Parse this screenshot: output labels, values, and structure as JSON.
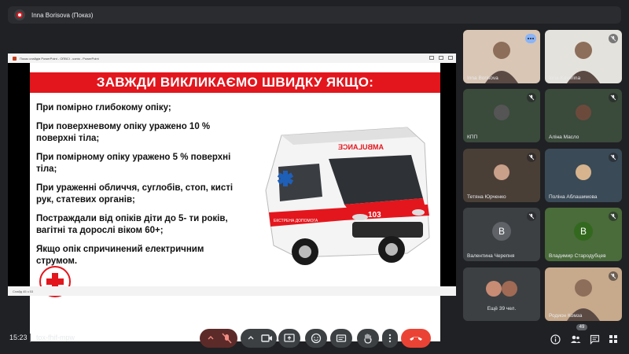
{
  "presenter": {
    "name": "Inna Borisova (Показ)"
  },
  "stage": {
    "window_title": "Показ слайдів PowerPoint - ОПВСІ - копія - PowerPoint",
    "status_text": "Слайд 45 з 53"
  },
  "slide": {
    "title": "ЗАВЖДИ ВИКЛИКАЄМО ШВИДКУ ЯКЩО:",
    "items": [
      "При помірно глибокому опіку;",
      "При поверхневому опіку уражено 10 % поверхні тіла;",
      "При помірному опіку уражено 5 % поверхні тіла;",
      "При ураженні обличчя, суглобів, стоп, кисті рук, статевих органів;",
      "Постраждали від опіків  діти до 5- ти років, вагітні та дорослі віком 60+;",
      "Якщо опік спричинений електричним струмом."
    ],
    "ambulance_text": "AMBULANCE",
    "ambulance_number": "103",
    "ambulance_side_text": "ЕКСТРЕНА ДОПОМОГА"
  },
  "participants": [
    {
      "name": "Inna Borisova",
      "type": "video",
      "bg": "#d9c6b5",
      "more": true
    },
    {
      "name": "Inna Keverina",
      "type": "video",
      "bg": "#e4e2dc",
      "more": false
    },
    {
      "name": "КПП",
      "type": "photo",
      "bg": "#3a4a3b",
      "avatar": "#555"
    },
    {
      "name": "Аліна Масло",
      "type": "photo",
      "bg": "#3a4a3b",
      "avatar": "#6b4a3c"
    },
    {
      "name": "Тетяна Юрченко",
      "type": "photo",
      "bg": "#4a3f37",
      "avatar": "#c9a08a"
    },
    {
      "name": "Поліна Аблашимова",
      "type": "photo",
      "bg": "#3a4a57",
      "avatar": "#d7b48e"
    },
    {
      "name": "Валентина Черепня",
      "type": "letter",
      "bg": "#3c4043",
      "letter": "B",
      "avatar": "#5f6368"
    },
    {
      "name": "Владимир Стародубцев",
      "type": "letter",
      "bg": "#4a6b3a",
      "letter": "B",
      "avatar": "#33691e"
    },
    {
      "name": "Ещё 39 чел.",
      "type": "group",
      "bg": "#3c4043"
    },
    {
      "name": "Родион Комза",
      "type": "video",
      "bg": "#c7a98b"
    }
  ],
  "bottombar": {
    "time": "15:23",
    "meeting_code": "tox-fhif-mpw",
    "participant_count": "49",
    "colors": {
      "end_call": "#ea4335",
      "mic_off": "#5c2b29",
      "control": "#3c4043"
    }
  }
}
